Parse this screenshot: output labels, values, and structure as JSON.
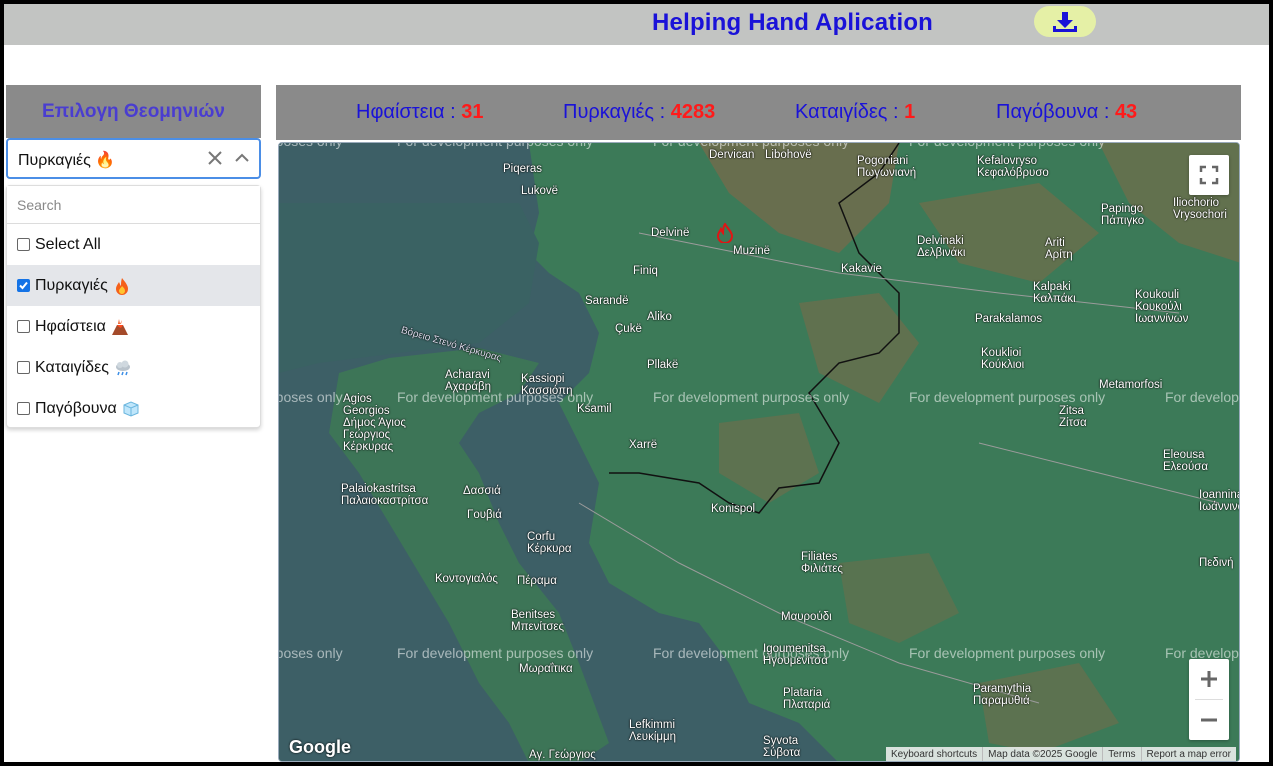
{
  "header": {
    "title": "Helping Hand Aplication",
    "download_icon": "download-icon"
  },
  "filter": {
    "title": "Επιλογη Θεομηνιών",
    "selected_value": "Πυρκαγιές 🔥",
    "search_placeholder": "Search",
    "options": [
      {
        "label": "Select All",
        "checked": false,
        "icon": ""
      },
      {
        "label": "Πυρκαγιές",
        "checked": true,
        "icon": "fire-icon"
      },
      {
        "label": "Ηφαίστεια",
        "checked": false,
        "icon": "volcano-icon"
      },
      {
        "label": "Καταιγίδες",
        "checked": false,
        "icon": "storm-cloud-icon"
      },
      {
        "label": "Παγόβουνα",
        "checked": false,
        "icon": "ice-cube-icon"
      }
    ]
  },
  "stats": [
    {
      "label": "Ηφαίστεια",
      "sep": " : ",
      "value": "31"
    },
    {
      "label": "Πυρκαγιές",
      "sep": " : ",
      "value": "4283"
    },
    {
      "label": "Καταιγίδες",
      "sep": " : ",
      "value": "1"
    },
    {
      "label": "Παγόβουνα",
      "sep": " : ",
      "value": "43"
    }
  ],
  "map": {
    "watermark": "For development purposes only",
    "watermark_cut": "rposes only",
    "watermark_cut2": "For develop",
    "logo": "Google",
    "attribution": [
      "Keyboard shortcuts",
      "Map data ©2025 Google",
      "Terms",
      "Report a map error"
    ],
    "labels": [
      "Piqeras",
      "Lukovë",
      "Delvinë",
      "Dervican",
      "Libohovë",
      "Muzinë",
      "Finiq",
      "Sarandë",
      "Çukë",
      "Aliko",
      "Kakavie",
      "Pogoniani\nΠωγωνιανή",
      "Kefalovryso\nΚεφαλόβρυσο",
      "Delvinaki\nΔελβινάκι",
      "Ariti\nΑρίτη",
      "Papingo\nΠάπιγκο",
      "Iliochorio\nVrysochori",
      "Kalpaki\nΚαλπάκι",
      "Koukouli\nΚουκούλι\nIωαννίνων",
      "Parakalamos",
      "Kouklioi\nΚούκλιοι",
      "Metamorfosi",
      "Zitsa\nΖίτσα",
      "Eleousa\nΕλεούσα",
      "Ioannina\nIωάννινα",
      "Acharavi\nΑχαράβη",
      "Kassiopi\nΚασσιόπη",
      "Ksamil",
      "Pllakë",
      "Agios\nGeorgios\nΔήμος Άγιος\nΓεώργιος\nΚέρκυρας",
      "Xarrë",
      "Palaiokastritsa\nΠαλαιοκαστρίτσα",
      "Δασσιά",
      "Γουβιά",
      "Konispol",
      "Corfu\nΚέρκυρα",
      "Κοντογιαλός",
      "Πέραμα",
      "Filiates\nΦιλιάτες",
      "Μαυρούδι",
      "Benitses\nΜπενίτσες",
      "Μωραΐτικα",
      "Igoumenitsa\nΗγουμενίτσα",
      "Paramythia\nΠαραμυθιά",
      "Plataria\nΠλαταριά",
      "Lefkimmi\nΛευκίμμη",
      "Αγ. Γεώργιος",
      "Syvota\nΣύβοτα",
      "Πεδινή",
      "Βόρειο Στενό Κέρκυρας"
    ]
  },
  "colors": {
    "title_blue": "#1a12d8",
    "count_red": "#ff1a1a",
    "panel_gray": "#8a8a8a",
    "header_gray": "#c2c4c2",
    "download_bg": "#e5f0a6"
  }
}
